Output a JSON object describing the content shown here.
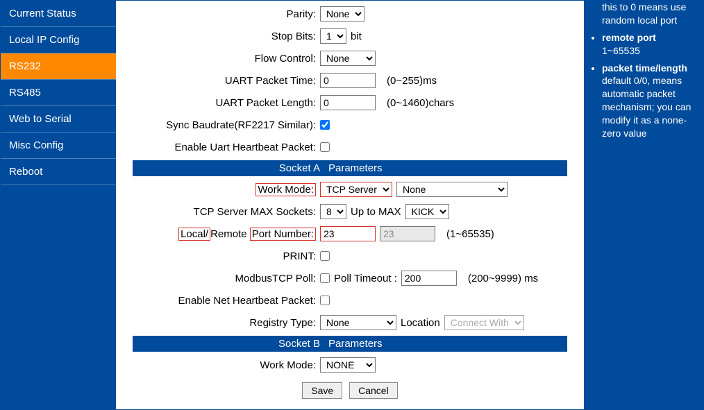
{
  "sidebar": {
    "items": [
      {
        "label": "Current Status"
      },
      {
        "label": "Local IP Config"
      },
      {
        "label": "RS232"
      },
      {
        "label": "RS485"
      },
      {
        "label": "Web to Serial"
      },
      {
        "label": "Misc Config"
      },
      {
        "label": "Reboot"
      }
    ],
    "activeIndex": 2
  },
  "form": {
    "parity": {
      "label": "Parity:",
      "value": "None"
    },
    "stopBits": {
      "label": "Stop Bits:",
      "value": "1",
      "unit": "bit"
    },
    "flowControl": {
      "label": "Flow Control:",
      "value": "None"
    },
    "uartPacketTime": {
      "label": "UART Packet Time:",
      "value": "0",
      "hint": "(0~255)ms"
    },
    "uartPacketLength": {
      "label": "UART Packet Length:",
      "value": "0",
      "hint": "(0~1460)chars"
    },
    "syncBaud": {
      "label": "Sync Baudrate(RF2217 Similar):",
      "checked": true
    },
    "uartHeartbeat": {
      "label": "Enable Uart Heartbeat Packet:",
      "checked": false
    },
    "socketA": {
      "headerLeft": "Socket A",
      "headerRight": "Parameters",
      "workMode": {
        "label": "Work Mode:",
        "value": "TCP Server",
        "secondary": "None"
      },
      "maxSockets": {
        "label": "TCP Server MAX Sockets:",
        "value": "8",
        "mid": "Up to MAX",
        "action": "KICK"
      },
      "port": {
        "prefix": "Local/",
        "mid": "Remote ",
        "label": "Port Number:",
        "local": "23",
        "remote": "23",
        "hint": "(1~65535)"
      },
      "print": {
        "label": "PRINT:",
        "checked": false
      },
      "modbus": {
        "label": "ModbusTCP Poll:",
        "checked": false,
        "timeoutLabel": "Poll Timeout :",
        "timeoutValue": "200",
        "timeoutHint": "(200~9999) ms"
      },
      "netHeartbeat": {
        "label": "Enable Net Heartbeat Packet:",
        "checked": false
      },
      "registry": {
        "label": "Registry Type:",
        "value": "None",
        "locLabel": "Location",
        "locValue": "Connect With"
      }
    },
    "socketB": {
      "headerLeft": "Socket B",
      "headerRight": "Parameters",
      "workMode": {
        "label": "Work Mode:",
        "value": "NONE"
      }
    }
  },
  "buttons": {
    "save": "Save",
    "cancel": "Cancel"
  },
  "help": {
    "frag0": "this to 0 means use random local port",
    "remotePortTitle": "remote port",
    "remotePortText": "1~65535",
    "packetTitle": "packet time/length",
    "packetText": "default 0/0, means automatic packet mechanism; you can modify it as a none-zero value"
  }
}
